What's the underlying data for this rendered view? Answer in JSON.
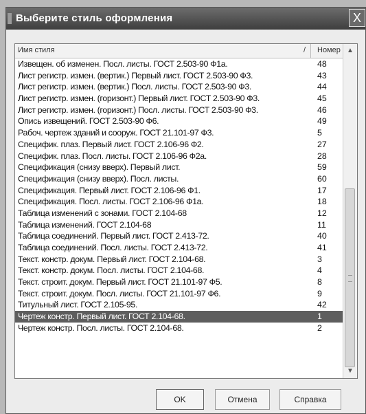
{
  "window": {
    "title": "Выберите стиль оформления",
    "close_label": "X"
  },
  "list": {
    "columns": {
      "name": "Имя стиля",
      "sort_marker": "/",
      "number": "Номер"
    },
    "rows": [
      {
        "name": "Извещен. об изменен. Посл. листы. ГОСТ 2.503-90 Ф1а.",
        "number": "48"
      },
      {
        "name": "Лист регистр. измен. (вертик.) Первый лист. ГОСТ 2.503-90 Ф3.",
        "number": "43"
      },
      {
        "name": "Лист регистр. измен. (вертик.) Посл. листы. ГОСТ 2.503-90 Ф3.",
        "number": "44"
      },
      {
        "name": "Лист регистр. измен. (горизонт.) Первый лист. ГОСТ 2.503-90 Ф3.",
        "number": "45"
      },
      {
        "name": "Лист регистр. измен. (горизонт.) Посл. листы. ГОСТ 2.503-90 Ф3.",
        "number": "46"
      },
      {
        "name": "Опись извещений. ГОСТ 2.503-90 Ф6.",
        "number": "49"
      },
      {
        "name": "Рабоч. чертеж зданий и сооруж. ГОСТ 21.101-97 Ф3.",
        "number": "5"
      },
      {
        "name": "Специфик. плаз. Первый лист. ГОСТ 2.106-96 Ф2.",
        "number": "27"
      },
      {
        "name": "Специфик. плаз. Посл. листы. ГОСТ 2.106-96 Ф2а.",
        "number": "28"
      },
      {
        "name": "Спецификация (снизу вверх). Первый лист.",
        "number": "59"
      },
      {
        "name": "Спецификация (снизу вверх). Посл. листы.",
        "number": "60"
      },
      {
        "name": "Спецификация. Первый лист. ГОСТ 2.106-96 Ф1.",
        "number": "17"
      },
      {
        "name": "Спецификация. Посл. листы. ГОСТ 2.106-96 Ф1а.",
        "number": "18"
      },
      {
        "name": "Таблица изменений с зонами. ГОСТ 2.104-68",
        "number": "12"
      },
      {
        "name": "Таблица изменений. ГОСТ 2.104-68",
        "number": "11"
      },
      {
        "name": "Таблица соединений. Первый лист. ГОСТ 2.413-72.",
        "number": "40"
      },
      {
        "name": "Таблица соединений. Посл. листы. ГОСТ 2.413-72.",
        "number": "41"
      },
      {
        "name": "Текст. констр. докум. Первый лист. ГОСТ 2.104-68.",
        "number": "3"
      },
      {
        "name": "Текст. констр. докум. Посл. листы. ГОСТ 2.104-68.",
        "number": "4"
      },
      {
        "name": "Текст. строит. докум. Первый лист. ГОСТ 21.101-97 Ф5.",
        "number": "8"
      },
      {
        "name": "Текст. строит. докум. Посл. листы. ГОСТ 21.101-97 Ф6.",
        "number": "9"
      },
      {
        "name": "Титульный лист. ГОСТ 2.105-95.",
        "number": "42"
      },
      {
        "name": "Чертеж констр. Первый лист. ГОСТ 2.104-68.",
        "number": "1",
        "selected": true
      },
      {
        "name": "Чертеж констр. Посл. листы. ГОСТ 2.104-68.",
        "number": "2"
      }
    ]
  },
  "buttons": {
    "ok": "OK",
    "cancel": "Отмена",
    "help": "Справка"
  },
  "colors": {
    "selection": "#5e5e5e",
    "titlebar": "#4a4a4a"
  }
}
